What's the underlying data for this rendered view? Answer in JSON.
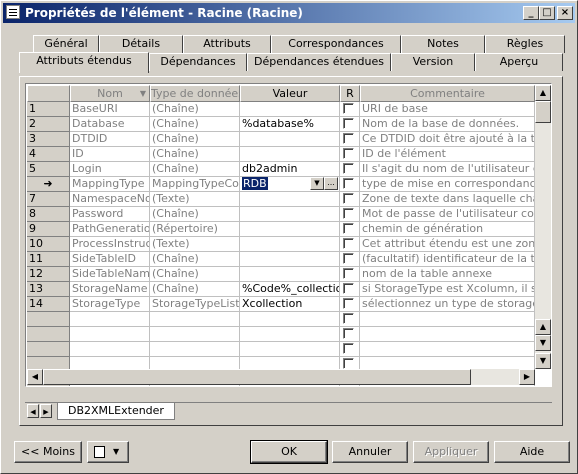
{
  "window": {
    "title": "Propriétés de l'élément - Racine (Racine)"
  },
  "title_buttons": {
    "minimize": "_",
    "maximize": "□",
    "close": "×"
  },
  "tabs_row1": [
    "Général",
    "Détails",
    "Attributs",
    "Correspondances",
    "Notes",
    "Règles"
  ],
  "tabs_row2": [
    "Attributs étendus",
    "Dépendances",
    "Dépendances étendues",
    "Version",
    "Aperçu"
  ],
  "active_tab": "Attributs étendus",
  "grid": {
    "headers": {
      "nom": "Nom",
      "type": "Type de données",
      "valeur": "Valeur",
      "r": "R",
      "commentaire": "Commentaire"
    },
    "rows": [
      {
        "num": "1",
        "nom": "BaseURI",
        "type": "(Chaîne)",
        "valeur": "",
        "commentaire": "URI de base"
      },
      {
        "num": "2",
        "nom": "Database",
        "type": "(Chaîne)",
        "valeur": "%database%",
        "commentaire": "Nom de la base de données."
      },
      {
        "num": "3",
        "nom": "DTDID",
        "type": "(Chaîne)",
        "valeur": "",
        "commentaire": "Ce DTDID doit être ajouté à la table"
      },
      {
        "num": "4",
        "nom": "ID",
        "type": "(Chaîne)",
        "valeur": "",
        "commentaire": "ID de l'élément"
      },
      {
        "num": "5",
        "nom": "Login",
        "type": "(Chaîne)",
        "valeur": "db2admin",
        "commentaire": "Il s'agit du nom de l'utilisateur conn"
      },
      {
        "num": "➜",
        "nom": "MappingType",
        "type": "MappingTypeColl",
        "valeur": "RDB",
        "commentaire": "type de mise en correspondance p"
      },
      {
        "num": "7",
        "nom": "NamespaceNod",
        "type": "(Texte)",
        "valeur": "",
        "commentaire": "Zone de texte dans laquelle chaq"
      },
      {
        "num": "8",
        "nom": "Password",
        "type": "(Chaîne)",
        "valeur": "",
        "commentaire": "Mot de passe de l'utilisateur conne"
      },
      {
        "num": "9",
        "nom": "PathGeneration",
        "type": "(Répertoire)",
        "valeur": "",
        "commentaire": "chemin de génération"
      },
      {
        "num": "10",
        "nom": "ProcessInstructi",
        "type": "(Texte)",
        "valeur": "",
        "commentaire": "Cet attribut étendu est une zone d"
      },
      {
        "num": "11",
        "nom": "SideTableID",
        "type": "(Chaîne)",
        "valeur": "",
        "commentaire": "(facultatif) identificateur de la table"
      },
      {
        "num": "12",
        "nom": "SideTableName",
        "type": "(Chaîne)",
        "valeur": "",
        "commentaire": "nom de la table annexe"
      },
      {
        "num": "13",
        "nom": "StorageName",
        "type": "(Chaîne)",
        "valeur": "%Code%_collection",
        "commentaire": "si StorageType est Xcolumn, il s'a"
      },
      {
        "num": "14",
        "nom": "StorageType",
        "type": "StorageTypeList",
        "valeur": "Xcollection",
        "commentaire": "sélectionnez un type de storage (X"
      }
    ],
    "empty_rows": 5,
    "selected_value_dropdown": "▼",
    "ellipsis_button": "..."
  },
  "sheet_tab": "DB2XMLExtender",
  "buttons": {
    "moins": "<< Moins",
    "ok": "OK",
    "annuler": "Annuler",
    "appliquer": "Appliquer",
    "aide": "Aide"
  },
  "colors": {
    "title_start": "#0a246a",
    "title_end": "#a6caf0",
    "face": "#d4d0c8",
    "selection": "#0a246a"
  }
}
